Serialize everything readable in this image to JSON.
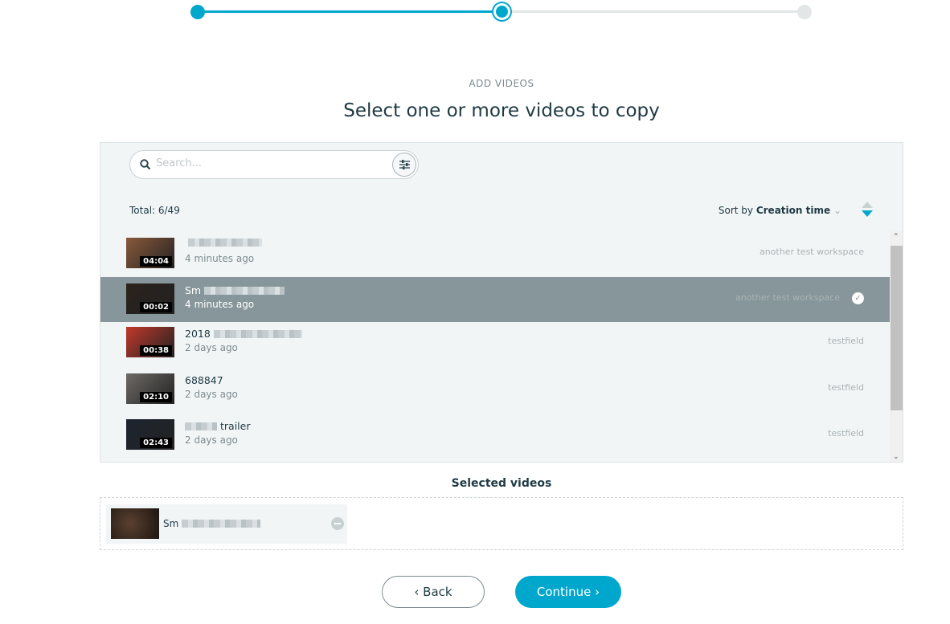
{
  "stepper": {
    "steps": 3,
    "current": 2,
    "accent": "#00a7cc"
  },
  "header": {
    "eyebrow": "ADD VIDEOS",
    "title": "Select one or more videos to copy"
  },
  "search": {
    "placeholder": "Search...",
    "value": ""
  },
  "list": {
    "total": "Total: 6/49",
    "sort_prefix": "Sort by",
    "sort_field": "Creation time",
    "items": [
      {
        "title": "",
        "duration": "04:04",
        "time": "4 minutes ago",
        "workspace": "another test workspace",
        "selected": false,
        "thumb": "#8a5a3c"
      },
      {
        "title": "Sm",
        "duration": "00:02",
        "time": "4 minutes ago",
        "workspace": "another test workspace",
        "selected": true,
        "thumb": "#2b221c"
      },
      {
        "title": "2018",
        "duration": "00:38",
        "time": "2 days ago",
        "workspace": "testfield",
        "selected": false,
        "thumb": "#c0392b"
      },
      {
        "title": "688847",
        "duration": "02:10",
        "time": "2 days ago",
        "workspace": "testfield",
        "selected": false,
        "thumb": "#6e6a66"
      },
      {
        "title": "trailer",
        "duration": "02:43",
        "time": "2 days ago",
        "workspace": "testfield",
        "selected": false,
        "thumb": "#1d2430"
      }
    ]
  },
  "selected": {
    "heading": "Selected videos",
    "items": [
      {
        "title": "Sm"
      }
    ]
  },
  "footer": {
    "back": "‹ Back",
    "continue": "Continue ›"
  }
}
